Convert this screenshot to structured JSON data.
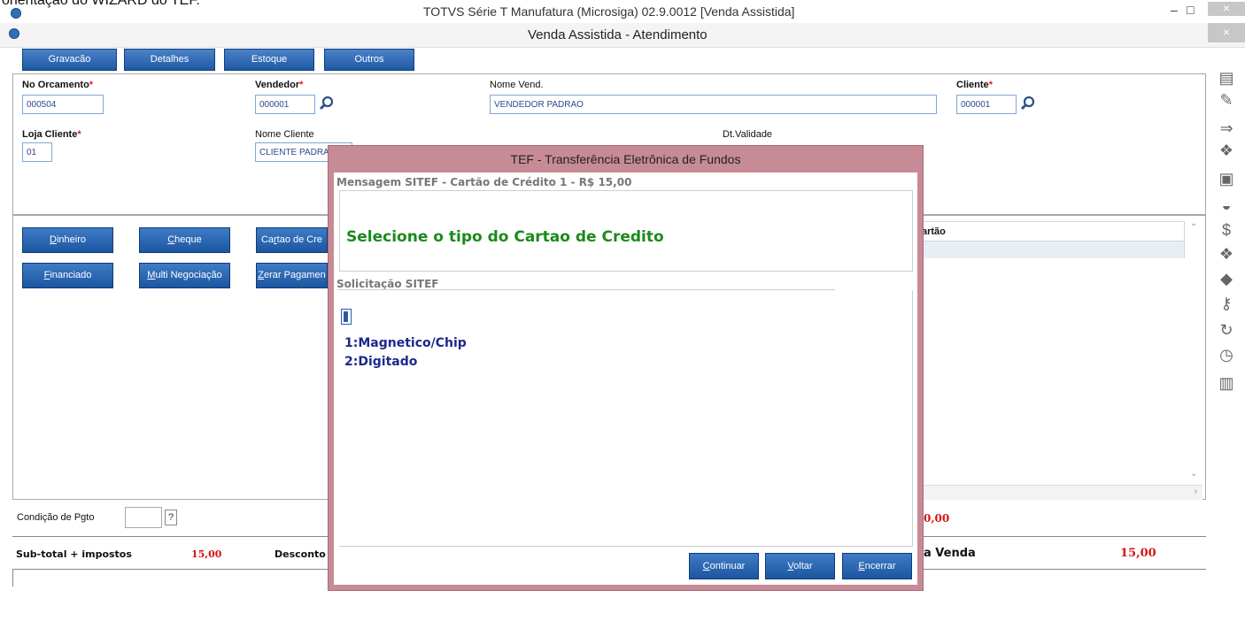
{
  "caption": "orientação do WIZARD do TEF.",
  "window": {
    "title": "TOTVS Série T Manufatura (Microsiga) 02.9.0012 [Venda Assistida]",
    "subtitle": "Venda Assistida - Atendimento",
    "minimize": "–",
    "maximize": "□",
    "close": "×"
  },
  "tabs": [
    "Gravacão",
    "Detalhes",
    "Estoque",
    "Outros"
  ],
  "form": {
    "orcamento_label": "No Orcamento",
    "orcamento_value": "000504",
    "vendedor_label": "Vendedor",
    "vendedor_value": "000001",
    "nome_vend_label": "Nome Vend.",
    "nome_vend_value": "VENDEDOR PADRAO",
    "cliente_label": "Cliente",
    "cliente_value": "000001",
    "loja_label": "Loja Cliente",
    "loja_value": "01",
    "nome_cliente_label": "Nome Cliente",
    "nome_cliente_value": "CLIENTE PADRAO",
    "dt_validade_label": "Dt.Validade",
    "required_mark": "*"
  },
  "payment_buttons": {
    "dinheiro": {
      "first": "D",
      "rest": "inheiro"
    },
    "cheque": {
      "first": "C",
      "rest": "heque"
    },
    "cartao": {
      "first": "Ca",
      "under": "r",
      "rest": "tao de Cre"
    },
    "financiado": {
      "first": "F",
      "rest": "inanciado"
    },
    "multi": {
      "first": "M",
      "rest": "ulti Negociação"
    },
    "zerar": {
      "first": "Z",
      "rest": "erar Pagamen"
    }
  },
  "grid": {
    "header_fragment": "artão"
  },
  "bottom": {
    "condicao_label": "Condição de Pgto",
    "condicao_help": "?",
    "troco_value": "0,00",
    "subtotal_label": "Sub-total + impostos",
    "subtotal_value": "15,00",
    "desconto_label": "Desconto ",
    "total_label": "a Venda",
    "total_value": "15,00"
  },
  "dialog": {
    "title": "TEF - Transferência Eletrônica de Fundos",
    "message_header": "Mensagem SITEF - Cartão de Crédito 1 - R$ 15,00",
    "message": "Selecione o tipo do Cartao de Credito",
    "solicitacao_header": "Solicitação SITEF",
    "options": [
      "1:Magnetico/Chip",
      "2:Digitado"
    ],
    "buttons": {
      "continuar": {
        "first": "C",
        "rest": "ontinuar"
      },
      "voltar": {
        "first": "V",
        "rest": "oltar"
      },
      "encerrar": {
        "first": "E",
        "rest": "ncerrar"
      }
    }
  },
  "toolbar_icons": [
    "save-icon",
    "pin-icon",
    "arrow-in-icon",
    "money-icon",
    "preview-icon",
    "car-icon",
    "currency-icon",
    "coins-icon",
    "eraser-icon",
    "key-icon",
    "refresh-icon",
    "clock-icon",
    "chart-icon"
  ]
}
